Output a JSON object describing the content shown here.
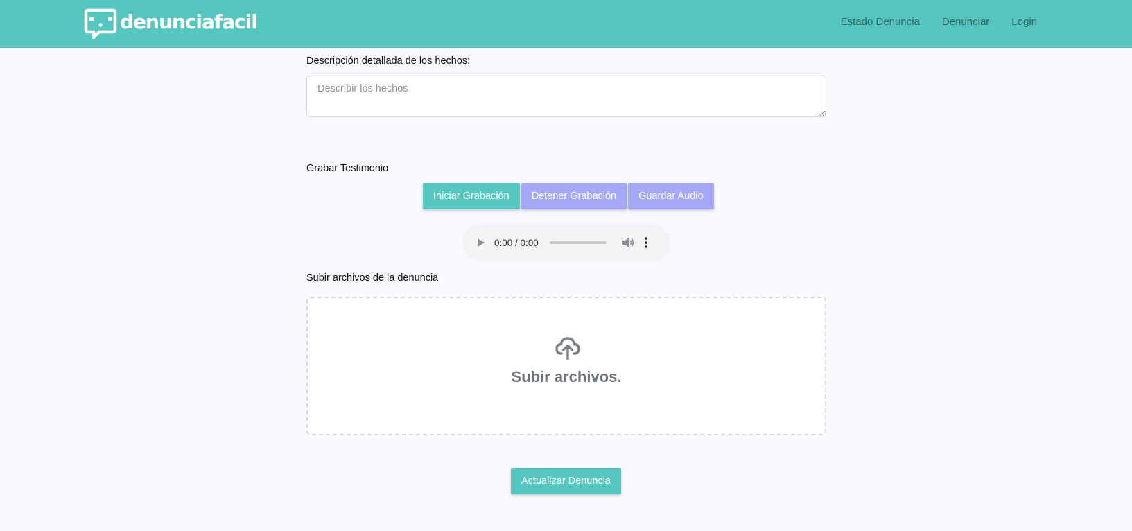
{
  "brand": {
    "name": "denunciafacil",
    "logo_icon": "chat-face-icon",
    "color": "#56c7c0"
  },
  "nav": {
    "items": [
      {
        "label": "Estado Denuncia"
      },
      {
        "label": "Denunciar"
      },
      {
        "label": "Login"
      }
    ]
  },
  "form": {
    "description": {
      "label": "Descripción detallada de los hechos:",
      "placeholder": "Describir los hechos",
      "value": ""
    },
    "recording": {
      "label": "Grabar Testimonio",
      "start_label": "Iniciar Grabación",
      "stop_label": "Detener Grabación",
      "save_label": "Guardar Audio",
      "start_color": "#56c7c0",
      "secondary_color": "#a4a8f6"
    },
    "audio": {
      "time": "0:00 / 0:00",
      "progress": 0
    },
    "upload": {
      "label": "Subir archivos de la denuncia",
      "dropzone_text": "Subir archivos.",
      "icon": "cloud-upload-icon"
    },
    "submit_label": "Actualizar Denuncia"
  }
}
